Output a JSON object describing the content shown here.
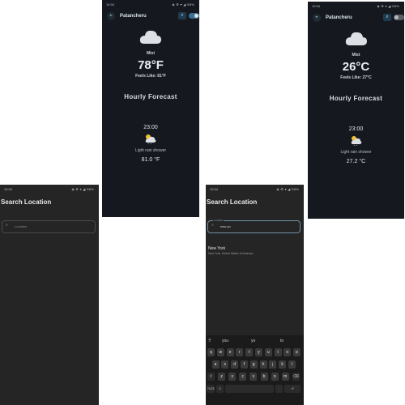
{
  "status": {
    "time": "10:34",
    "icons": "◈ ⚙ ▾ ◢ 98%"
  },
  "weather_f": {
    "city": "Patancheru",
    "condition": "Mist",
    "temp": "78°F",
    "feels_like": "Feels Like: 81°F",
    "hourly_title": "Hourly Forecast",
    "hour": "23:00",
    "hour_desc": "Light rain shower",
    "hour_temp": "81.0 °F",
    "toggle_on": true
  },
  "weather_c": {
    "city": "Patancheru",
    "condition": "Mist",
    "temp": "26°C",
    "feels_like": "Feels Like: 27°C",
    "hourly_title": "Hourly Forecast",
    "hour": "23:00",
    "hour_desc": "Light rain shower",
    "hour_temp": "27.2 °C",
    "toggle_on": false
  },
  "search_empty": {
    "title": "Search Location",
    "placeholder": "Location"
  },
  "search_typed": {
    "title": "Search Location",
    "field_label": "Location",
    "value": "new yo",
    "result_name": "New York",
    "result_sub": "New York, United States of America"
  },
  "keyboard": {
    "suggestions": [
      "you",
      "yo",
      "to"
    ],
    "row1": [
      "q",
      "w",
      "e",
      "r",
      "t",
      "y",
      "u",
      "i",
      "o",
      "p"
    ],
    "row2": [
      "a",
      "s",
      "d",
      "f",
      "g",
      "h",
      "j",
      "k",
      "l"
    ],
    "row3": [
      "⇧",
      "z",
      "x",
      "c",
      "v",
      "b",
      "n",
      "m",
      "⌫"
    ],
    "row4": [
      "?123",
      "☺",
      "",
      "",
      "",
      "",
      "",
      ".",
      "⏎"
    ]
  },
  "colors": {
    "screen_bg": "#15191f",
    "search_bg": "#252525",
    "accent": "#3f6f93"
  }
}
